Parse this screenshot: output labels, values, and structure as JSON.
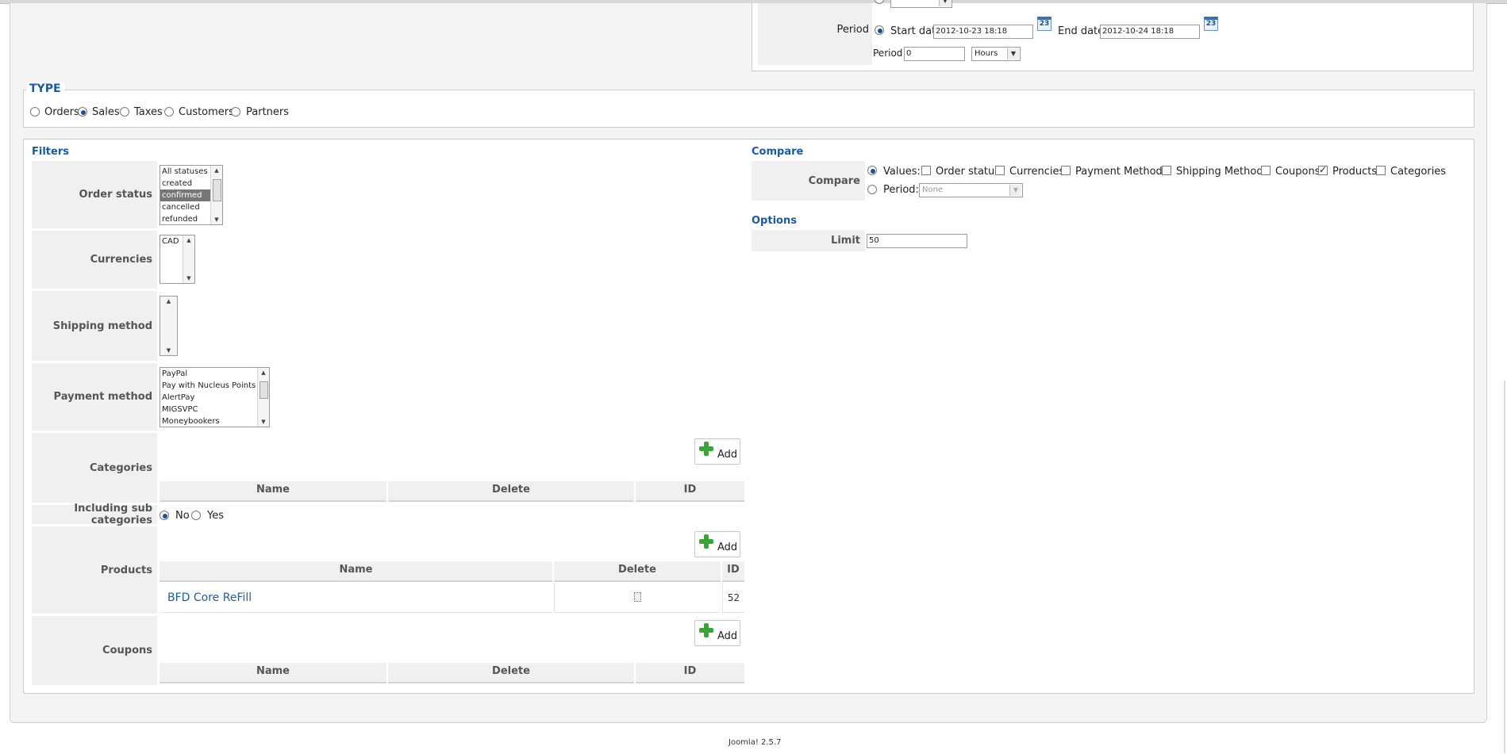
{
  "period": {
    "label": "Period",
    "start_label": "Start date",
    "start_value": "2012-10-23 18:18",
    "end_label": "End date",
    "end_value": "2012-10-24 18:18",
    "period_label": "Period",
    "period_value": "0",
    "unit_value": "Hours",
    "calendar_day": "23"
  },
  "type": {
    "legend": "TYPE",
    "options": [
      "Orders",
      "Sales",
      "Taxes",
      "Customers",
      "Partners"
    ],
    "selected": "Sales"
  },
  "filters": {
    "heading": "Filters",
    "order_status": {
      "label": "Order status",
      "options": [
        "All statuses",
        "created",
        "confirmed",
        "cancelled",
        "refunded"
      ],
      "selected": "confirmed"
    },
    "currencies": {
      "label": "Currencies",
      "options": [
        "CAD"
      ]
    },
    "shipping_method": {
      "label": "Shipping method"
    },
    "payment_method": {
      "label": "Payment method",
      "options": [
        "PayPal",
        "Pay with Nucleus Points",
        "AlertPay",
        "MIGSVPC",
        "Moneybookers"
      ]
    },
    "categories": {
      "label": "Categories",
      "add_label": "Add",
      "columns": [
        "Name",
        "Delete",
        "ID"
      ]
    },
    "sub_categories": {
      "label": "Including sub categories",
      "no": "No",
      "yes": "Yes",
      "selected": "No"
    },
    "products": {
      "label": "Products",
      "add_label": "Add",
      "columns": [
        "Name",
        "Delete",
        "ID"
      ],
      "rows": [
        {
          "name": "BFD Core ReFill",
          "id": "52"
        }
      ]
    },
    "coupons": {
      "label": "Coupons",
      "add_label": "Add",
      "columns": [
        "Name",
        "Delete",
        "ID"
      ]
    }
  },
  "compare": {
    "heading": "Compare",
    "label": "Compare",
    "values_label": "Values:",
    "checks": [
      {
        "label": "Order status",
        "checked": false
      },
      {
        "label": "Currencies",
        "checked": false
      },
      {
        "label": "Payment Methods",
        "checked": false
      },
      {
        "label": "Shipping Methods",
        "checked": false
      },
      {
        "label": "Coupons",
        "checked": false
      },
      {
        "label": "Products",
        "checked": true
      },
      {
        "label": "Categories",
        "checked": false
      }
    ],
    "period_label": "Period:",
    "period_value": "None"
  },
  "options": {
    "heading": "Options",
    "limit_label": "Limit",
    "limit_value": "50"
  },
  "footer": {
    "text": "Joomla! 2.5.7"
  }
}
